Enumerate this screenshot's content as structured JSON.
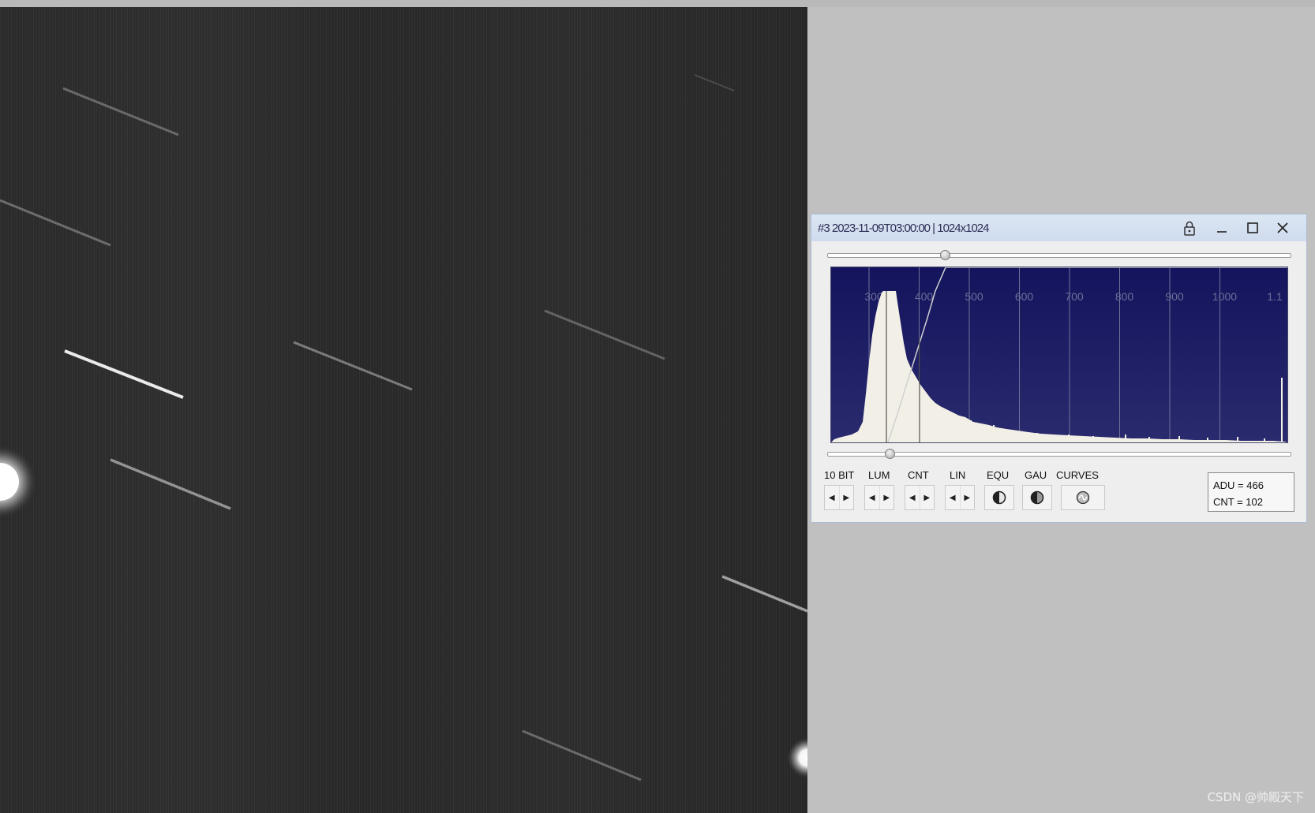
{
  "window": {
    "title": "#3 2023-11-09T03:00:00 | 1024x1024",
    "buttons": {
      "lock": "lock-icon",
      "minimize": "minimize-icon",
      "maximize": "maximize-icon",
      "close": "close-icon"
    }
  },
  "histogram": {
    "ticks": [
      "300",
      "400",
      "500",
      "600",
      "700",
      "800",
      "900",
      "1000",
      "1.1"
    ],
    "colors": {
      "background_top": "#14145e",
      "background_bottom": "#2a2a6e",
      "fill": "#f2f0e6",
      "grid": "#6e7296"
    },
    "upper_slider_fraction": 0.255,
    "lower_slider_fraction": 0.135
  },
  "controls": {
    "labels": {
      "bits": "10 BIT",
      "lum": "LUM",
      "cnt": "CNT",
      "lin": "LIN",
      "equ": "EQU",
      "gau": "GAU",
      "curves": "CURVES"
    }
  },
  "readout": {
    "adu": "ADU = 466",
    "cnt": "CNT = 102"
  },
  "watermark": "CSDN @帅殿天下"
}
